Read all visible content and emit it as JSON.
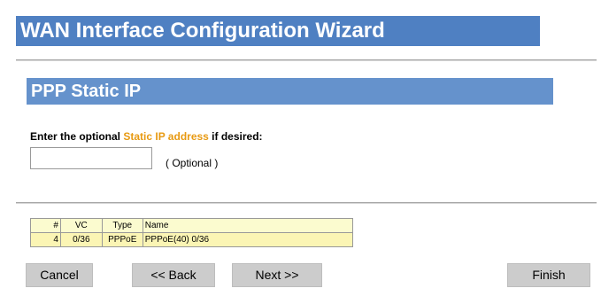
{
  "wizard": {
    "title": "WAN Interface Configuration Wizard"
  },
  "section": {
    "title": "PPP Static IP"
  },
  "prompt": {
    "prefix": "Enter the optional ",
    "highlight": "Static IP address",
    "suffix": " if desired:"
  },
  "static_ip": {
    "value": "",
    "note": "( Optional )"
  },
  "vc_table": {
    "headers": {
      "num": "#",
      "vc": "VC",
      "type": "Type",
      "name": "Name"
    },
    "rows": [
      {
        "num": "4",
        "vc": "0/36",
        "type": "PPPoE",
        "name": "PPPoE(40) 0/36"
      }
    ]
  },
  "buttons": {
    "cancel": "Cancel",
    "back": "<< Back",
    "next": "Next >>",
    "finish": "Finish"
  },
  "colors": {
    "title_bar": "#4f80c2",
    "section_bar": "#6592cc",
    "highlight_text": "#e89a12",
    "table_background": "#fbfbcf",
    "button_background": "#cccccc"
  }
}
